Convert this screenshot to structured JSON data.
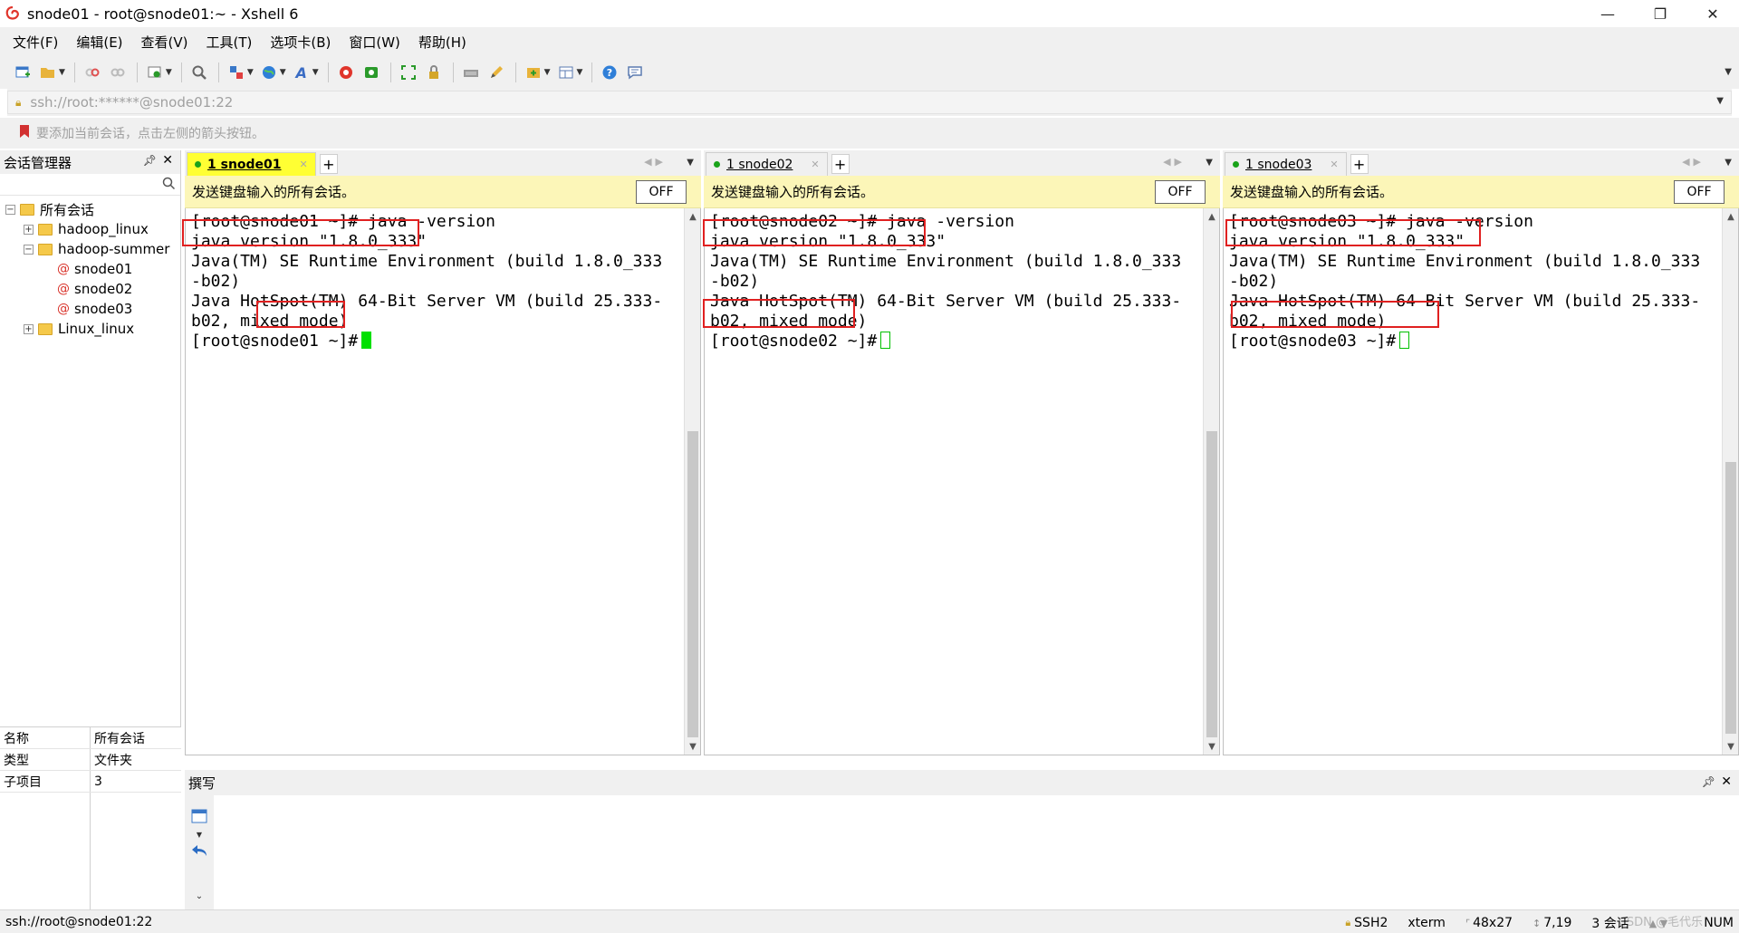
{
  "window": {
    "title": "snode01 - root@snode01:~ - Xshell 6",
    "minimize": "—",
    "restore": "❐",
    "close": "✕"
  },
  "menu": [
    "文件(F)",
    "编辑(E)",
    "查看(V)",
    "工具(T)",
    "选项卡(B)",
    "窗口(W)",
    "帮助(H)"
  ],
  "address": {
    "value": "ssh://root:******@snode01:22"
  },
  "hint": "要添加当前会话，点击左侧的箭头按钮。",
  "session_manager": {
    "title": "会话管理器",
    "tree": {
      "root": "所有会话",
      "folder1": "hadoop_linux",
      "folder2": "hadoop-summer",
      "s1": "snode01",
      "s2": "snode02",
      "s3": "snode03",
      "folder3": "Linux_linux"
    },
    "props": [
      {
        "k": "名称",
        "v": "所有会话"
      },
      {
        "k": "类型",
        "v": "文件夹"
      },
      {
        "k": "子项目",
        "v": "3"
      }
    ]
  },
  "send_bar": {
    "text": "发送键盘输入的所有会话。",
    "button": "OFF"
  },
  "panes": [
    {
      "tab": "1 snode01",
      "lines": [
        "[root@snode01 ~]# java -version",
        "java version \"1.8.0_333\"",
        "Java(TM) SE Runtime Environment (build 1.8.0_333",
        "-b02)",
        "Java HotSpot(TM) 64-Bit Server VM (build 25.333-",
        "b02, mixed mode)",
        "[root@snode01 ~]#"
      ]
    },
    {
      "tab": "1 snode02",
      "lines": [
        "[root@snode02 ~]# java -version",
        "java version \"1.8.0_333\"",
        "Java(TM) SE Runtime Environment (build 1.8.0_333",
        "-b02)",
        "Java HotSpot(TM) 64-Bit Server VM (build 25.333-",
        "b02, mixed mode)",
        "[root@snode02 ~]#"
      ]
    },
    {
      "tab": "1 snode03",
      "lines": [
        "[root@snode03 ~]# java -version",
        "java version \"1.8.0_333\"",
        "Java(TM) SE Runtime Environment (build 1.8.0_333",
        "-b02)",
        "Java HotSpot(TM) 64-Bit Server VM (build 25.333-",
        "b02, mixed mode)",
        "[root@snode03 ~]#"
      ]
    }
  ],
  "compose": {
    "title": "撰写"
  },
  "status": {
    "left": "ssh://root@snode01:22",
    "protocol": "SSH2",
    "term": "xterm",
    "size": "48x27",
    "pos": "7,19",
    "sessions": "3 会话",
    "num": "NUM",
    "watermark": "CSDN @毛代乐"
  },
  "colors": {
    "active_tab": "#ffff33",
    "send_bar": "#fcf6b8",
    "highlight": "#e02020",
    "cursor": "#00e000"
  }
}
